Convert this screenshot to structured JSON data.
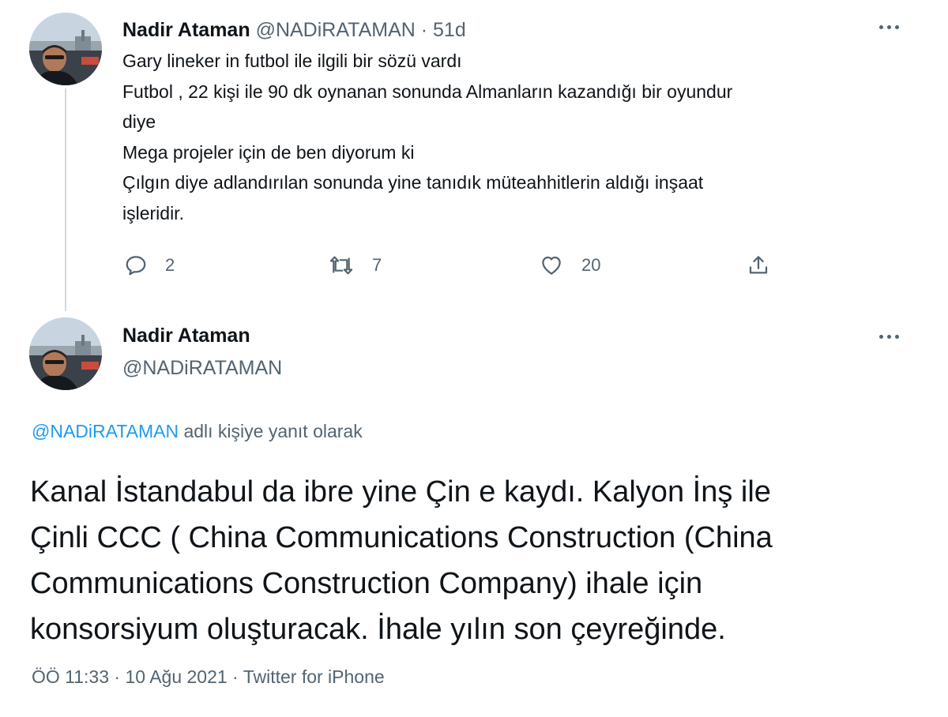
{
  "parent_tweet": {
    "author_name": "Nadir Ataman",
    "author_handle": "@NADiRATAMAN",
    "separator": "·",
    "timestamp": "51d",
    "lines": [
      "Gary lineker in futbol ile ilgili bir sözü vardı",
      "Futbol , 22 kişi ile 90 dk oynanan sonunda Almanların kazandığı bir oyundur",
      "diye",
      "Mega projeler için de ben diyorum ki",
      "Çılgın diye adlandırılan sonunda yine tanıdık müteahhitlerin aldığı inşaat",
      "işleridir."
    ],
    "actions": {
      "reply_count": "2",
      "retweet_count": "7",
      "like_count": "20"
    }
  },
  "main_tweet": {
    "author_name": "Nadir Ataman",
    "author_handle": "@NADiRATAMAN",
    "reply_to_mention": "@NADiRATAMAN",
    "reply_to_suffix": " adlı kişiye yanıt olarak",
    "lines": [
      "Kanal İstandabul da ibre yine Çin e kaydı. Kalyon İnş ile",
      "Çinli CCC ( China Communications Construction (China",
      "Communications Construction Company) ihale için",
      "konsorsiyum oluşturacak. İhale yılın son çeyreğinde."
    ],
    "meta": {
      "time": "ÖÖ 11:33",
      "separator_1": " · ",
      "date": "10 Ağu 2021",
      "separator_2": " · ",
      "source": "Twitter for iPhone"
    }
  },
  "icons": {
    "reply": "reply-icon",
    "retweet": "retweet-icon",
    "like": "heart-icon",
    "share": "share-icon",
    "more": "more-icon"
  },
  "colors": {
    "text": "#0f1419",
    "secondary": "#536471",
    "link": "#1d9bf0",
    "thread_line": "#cfd9de"
  }
}
